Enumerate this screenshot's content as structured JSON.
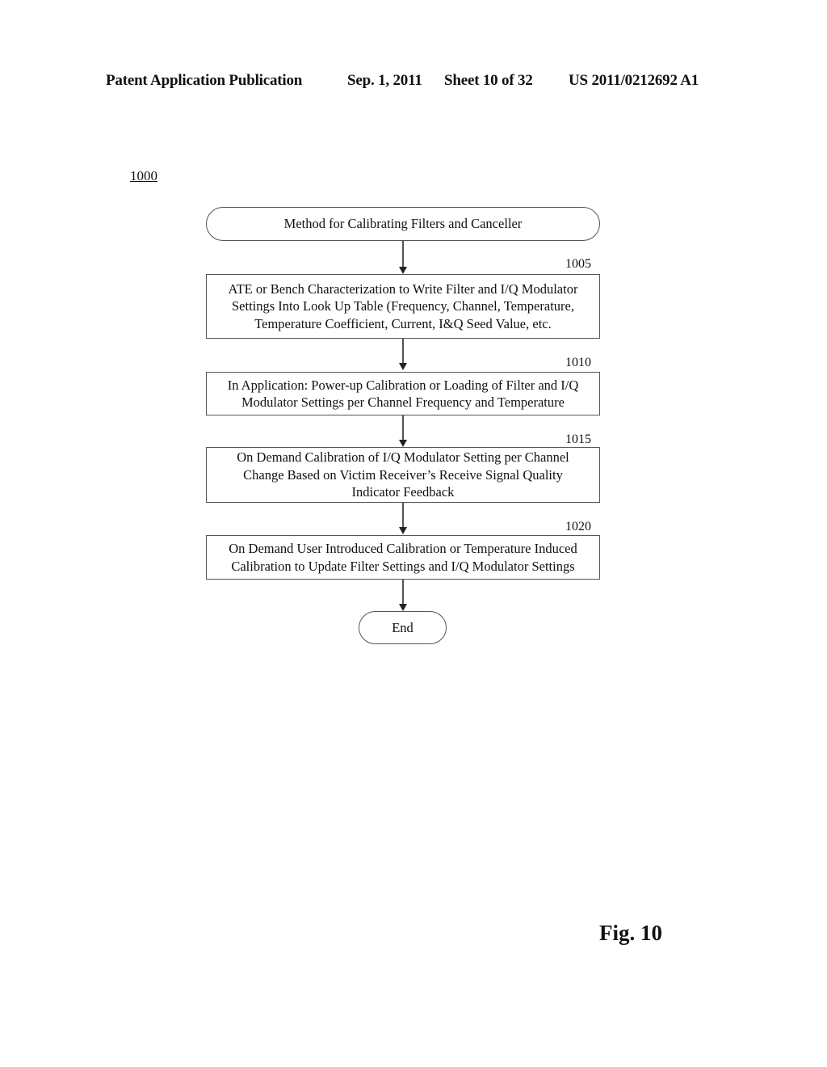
{
  "header": {
    "publication_type": "Patent Application Publication",
    "date": "Sep. 1, 2011",
    "sheet": "Sheet 10 of 32",
    "publication_number": "US 2011/0212692 A1"
  },
  "figure_ref": "1000",
  "flowchart": {
    "start": {
      "label": "Method for Calibrating Filters and Canceller"
    },
    "steps": [
      {
        "ref": "1005",
        "lines": [
          "ATE or Bench Characterization to Write Filter and I/Q Modulator",
          "Settings Into Look Up Table (Frequency, Channel, Temperature,",
          "Temperature Coefficient, Current, I&Q Seed Value, etc."
        ]
      },
      {
        "ref": "1010",
        "lines": [
          "In Application:  Power-up Calibration or Loading of Filter and I/Q",
          "Modulator Settings per Channel Frequency and Temperature"
        ]
      },
      {
        "ref": "1015",
        "lines": [
          "On Demand Calibration of I/Q Modulator Setting per Channel",
          "Change Based on Victim Receiver’s Receive Signal Quality",
          "Indicator Feedback"
        ]
      },
      {
        "ref": "1020",
        "lines": [
          "On Demand User Introduced Calibration or Temperature Induced",
          "Calibration to Update Filter Settings and I/Q Modulator Settings"
        ]
      }
    ],
    "end": {
      "label": "End"
    }
  },
  "figure_label": "Fig. 10"
}
